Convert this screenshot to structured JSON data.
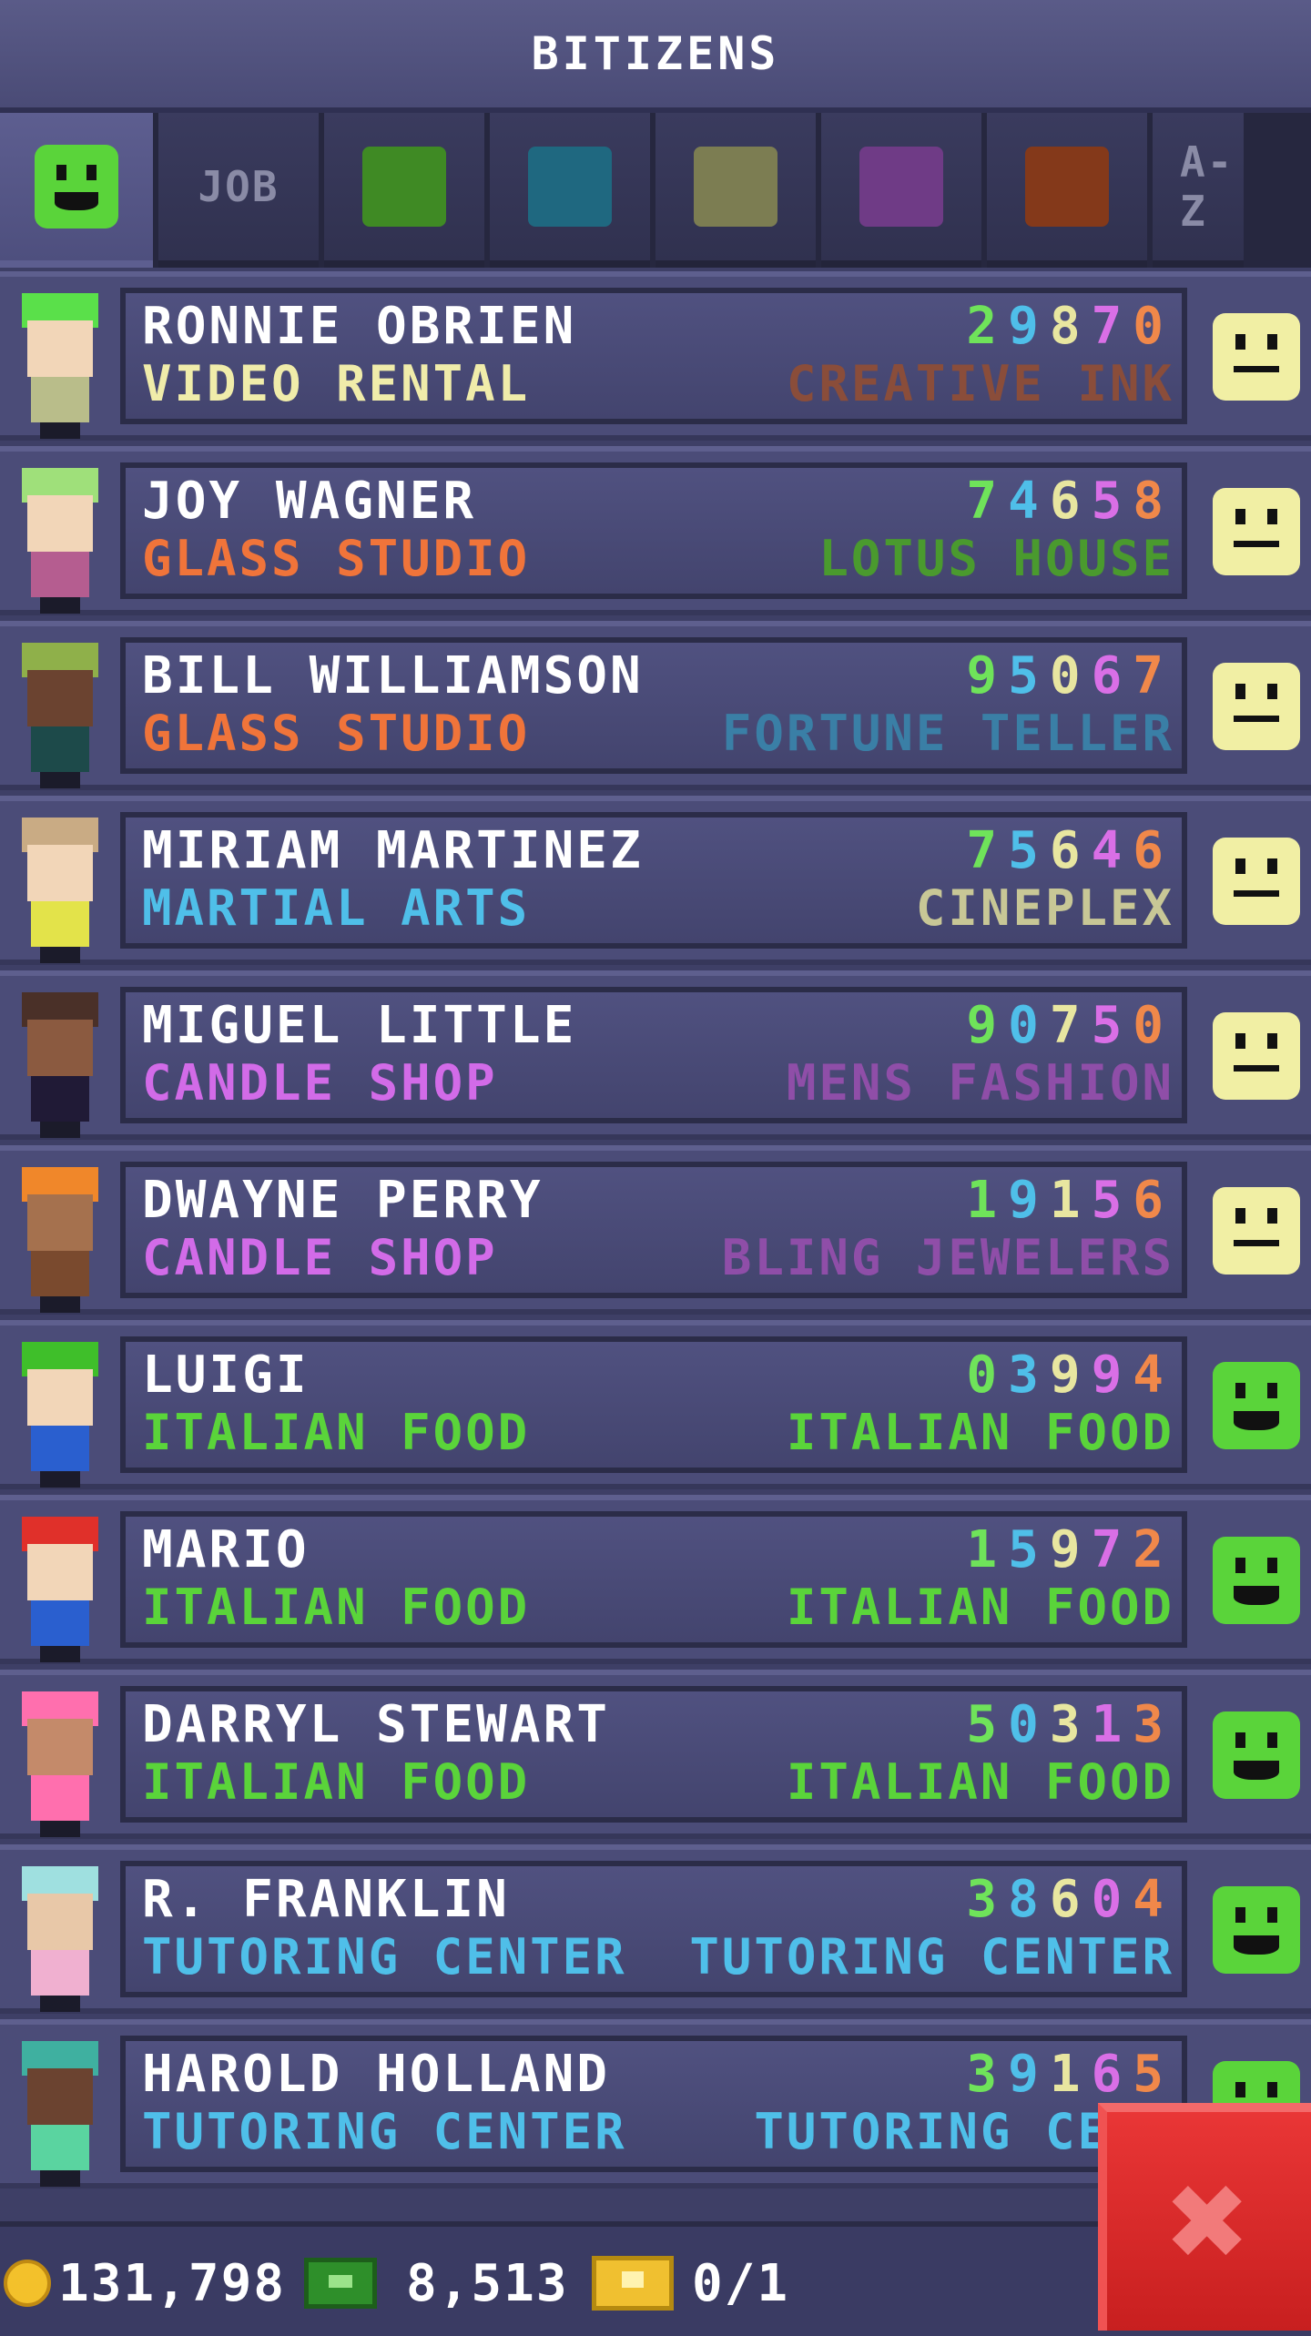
{
  "header": {
    "title": "BITIZENS"
  },
  "tabs": [
    {
      "type": "face",
      "icon": "happy-face-icon",
      "color": "#5ad43a"
    },
    {
      "type": "text",
      "label": "JOB"
    },
    {
      "type": "swatch",
      "icon": "green-category-icon",
      "color": "#3f8a24"
    },
    {
      "type": "swatch",
      "icon": "blue-category-icon",
      "color": "#1f6880"
    },
    {
      "type": "swatch",
      "icon": "olive-category-icon",
      "color": "#7c7d52"
    },
    {
      "type": "swatch",
      "icon": "purple-category-icon",
      "color": "#6f3b86"
    },
    {
      "type": "swatch",
      "icon": "brown-category-icon",
      "color": "#84391a"
    },
    {
      "type": "text",
      "label": "A-Z"
    }
  ],
  "colors": {
    "neutral_face": "#f1efa4",
    "happy_face": "#5ad43a",
    "creative": "#e58b55",
    "service": "#4fbfe9",
    "retail": "#d26be8",
    "food": "#5ad43a",
    "recreation": "#f0ecaa"
  },
  "rows": [
    {
      "name": "RONNIE OBRIEN",
      "id": "29870",
      "job": "VIDEO RENTAL",
      "job_color": "#f0ecaa",
      "work": "CREATIVE INK",
      "work_color": "#8a4d3a",
      "mood": "neutral",
      "hair": "#5ae04a",
      "skin": "#f2d6b8",
      "shirt": "#b9bd8a"
    },
    {
      "name": "JOY WAGNER",
      "id": "74658",
      "job": "GLASS STUDIO",
      "job_color": "#f0743a",
      "work": "LOTUS HOUSE",
      "work_color": "#4a9a2e",
      "mood": "neutral",
      "hair": "#9fe07a",
      "skin": "#f2d6b8",
      "shirt": "#b55d90"
    },
    {
      "name": "BILL WILLIAMSON",
      "id": "95067",
      "job": "GLASS STUDIO",
      "job_color": "#f0743a",
      "work": "FORTUNE TELLER",
      "work_color": "#3a7fa6",
      "mood": "neutral",
      "hair": "#8fb04a",
      "skin": "#6b4330",
      "shirt": "#1d4a4a"
    },
    {
      "name": "MIRIAM MARTINEZ",
      "id": "75646",
      "job": "MARTIAL ARTS",
      "job_color": "#4fbfe9",
      "work": "CINEPLEX",
      "work_color": "#c8c796",
      "mood": "neutral",
      "hair": "#c9ab84",
      "skin": "#f2d6b8",
      "shirt": "#e3e34a"
    },
    {
      "name": "MIGUEL LITTLE",
      "id": "90750",
      "job": "CANDLE SHOP",
      "job_color": "#d26be8",
      "work": "MENS FASHION",
      "work_color": "#8f4ea8",
      "mood": "neutral",
      "hair": "#4a3028",
      "skin": "#8b5a40",
      "shirt": "#201a36"
    },
    {
      "name": "DWAYNE PERRY",
      "id": "19156",
      "job": "CANDLE SHOP",
      "job_color": "#d26be8",
      "work": "BLING JEWELERS",
      "work_color": "#8f4ea8",
      "mood": "neutral",
      "hair": "#f0872a",
      "skin": "#a5714e",
      "shirt": "#7a4a2e"
    },
    {
      "name": "LUIGI",
      "id": "03994",
      "job": "ITALIAN FOOD",
      "job_color": "#5ad43a",
      "work": "ITALIAN FOOD",
      "work_color": "#5ad43a",
      "mood": "happy",
      "hair": "#3fbf2a",
      "skin": "#f2d6b8",
      "shirt": "#2a5fcf"
    },
    {
      "name": "MARIO",
      "id": "15972",
      "job": "ITALIAN FOOD",
      "job_color": "#5ad43a",
      "work": "ITALIAN FOOD",
      "work_color": "#5ad43a",
      "mood": "happy",
      "hair": "#e0302a",
      "skin": "#f2d6b8",
      "shirt": "#2a5fcf"
    },
    {
      "name": "DARRYL STEWART",
      "id": "50313",
      "job": "ITALIAN FOOD",
      "job_color": "#5ad43a",
      "work": "ITALIAN FOOD",
      "work_color": "#5ad43a",
      "mood": "happy",
      "hair": "#ff6fae",
      "skin": "#c48a6a",
      "shirt": "#ff6fae"
    },
    {
      "name": "R. FRANKLIN",
      "id": "38604",
      "job": "TUTORING CENTER",
      "job_color": "#4fbfe9",
      "work": "TUTORING CENTER",
      "work_color": "#4fbfe9",
      "mood": "happy",
      "hair": "#9fe0e0",
      "skin": "#e8c8a8",
      "shirt": "#f0b0d0"
    },
    {
      "name": "HAROLD HOLLAND",
      "id": "39165",
      "job": "TUTORING CENTER",
      "job_color": "#4fbfe9",
      "work": "TUTORING CENT",
      "work_color": "#4fbfe9",
      "mood": "happy",
      "hair": "#3fb0a0",
      "skin": "#6b4330",
      "shirt": "#5ad4a0"
    }
  ],
  "footer": {
    "coins": "131,798",
    "cash": "8,513",
    "bux": "0/1"
  },
  "close_button": {
    "icon": "close-icon",
    "label": "✖"
  }
}
